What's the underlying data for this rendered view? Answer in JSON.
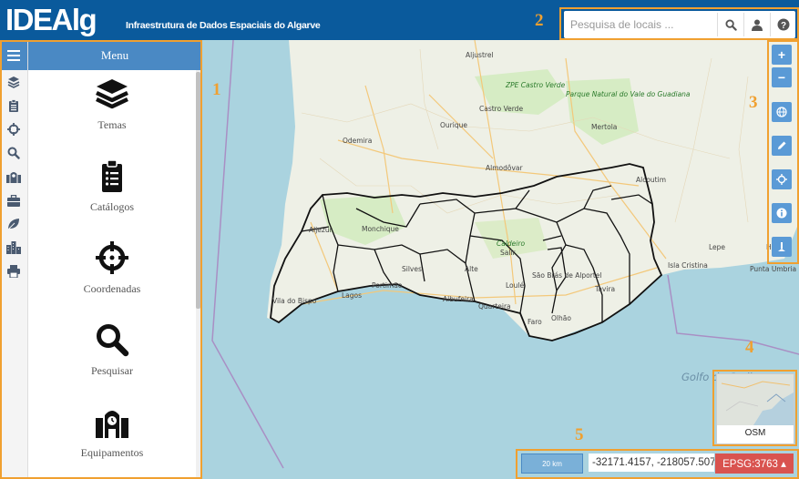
{
  "header": {
    "logo": "IDEAlg",
    "subtitle": "Infraestrutura de Dados Espaciais do Algarve",
    "search_placeholder": "Pesquisa de locais ...",
    "search_icon": "search-icon",
    "user_icon": "user-icon",
    "help_icon": "help-icon"
  },
  "sidebar": {
    "menu_title": "Menu",
    "iconbar": [
      "menu-icon",
      "layers-icon",
      "clipboard-icon",
      "crosshair-icon",
      "search-icon",
      "facilities-icon",
      "briefcase-icon",
      "leaf-icon",
      "buildings-icon",
      "print-icon"
    ],
    "items": [
      {
        "label": "Temas",
        "icon": "layers-icon"
      },
      {
        "label": "Catálogos",
        "icon": "clipboard-icon"
      },
      {
        "label": "Coordenadas",
        "icon": "crosshair-icon"
      },
      {
        "label": "Pesquisar",
        "icon": "search-icon"
      },
      {
        "label": "Equipamentos",
        "icon": "facilities-icon"
      }
    ]
  },
  "map": {
    "labels": [
      "Aljustrel",
      "ZPE Castro Verde",
      "Castro Verde",
      "Ourique",
      "Parque Natural do Vale do Guadiana",
      "Mertola",
      "Odemira",
      "Almodôvar",
      "Alcoutim",
      "Monchique",
      "Aljezur",
      "Caldeiro",
      "Salir",
      "Alte",
      "Silves",
      "Portimão",
      "Lagos",
      "Vila do Bispo",
      "Albufeira",
      "Quarteira",
      "Loulé",
      "São Brás de Alportel",
      "Tavira",
      "Faro",
      "Olhão",
      "Lepe",
      "Isla Cristina",
      "Punta Umbria",
      "Golfo de Cadiz",
      "Huelva"
    ],
    "overview_label": "OSM"
  },
  "tools": {
    "zoom_in": "+",
    "zoom_out": "−",
    "icons": [
      "globe-icon",
      "pencil-icon",
      "locate-icon",
      "info-icon",
      "measure-icon"
    ]
  },
  "footer": {
    "scale": "20 km",
    "coordinates": "-32171.4157, -218057.5073",
    "epsg": "EPSG:3763 ▴"
  },
  "annotations": [
    "1",
    "2",
    "3",
    "4",
    "5"
  ],
  "colors": {
    "header": "#0a5a9c",
    "accent": "#4a89c4",
    "annotation": "#f0a030",
    "epsg": "#d9534f",
    "sea": "#aad3df",
    "land": "#eef0e6"
  }
}
